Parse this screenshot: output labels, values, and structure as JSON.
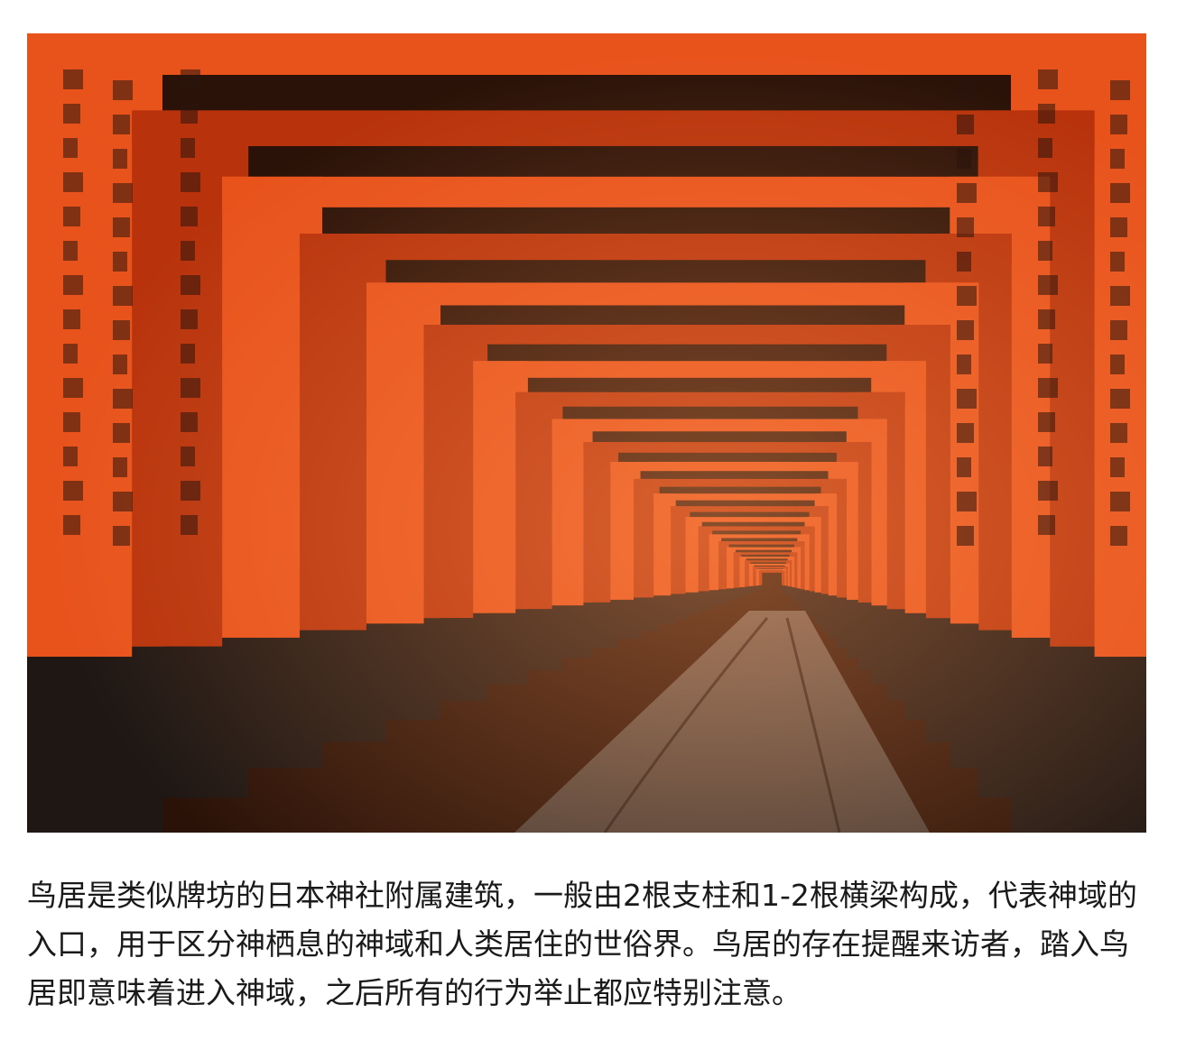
{
  "image": {
    "subject": "torii-tunnel-photo",
    "colors": {
      "torii": "#e8531c",
      "torii_dark": "#b8330c",
      "base": "#1e1714",
      "path": "#5a504a"
    }
  },
  "caption": {
    "text": "鸟居是类似牌坊的日本神社附属建筑，一般由2根支柱和1-2根横梁构成，代表神域的入口，用于区分神栖息的神域和人类居住的世俗界。鸟居的存在提醒来访者，踏入鸟居即意味着进入神域，之后所有的行为举止都应特别注意。"
  }
}
